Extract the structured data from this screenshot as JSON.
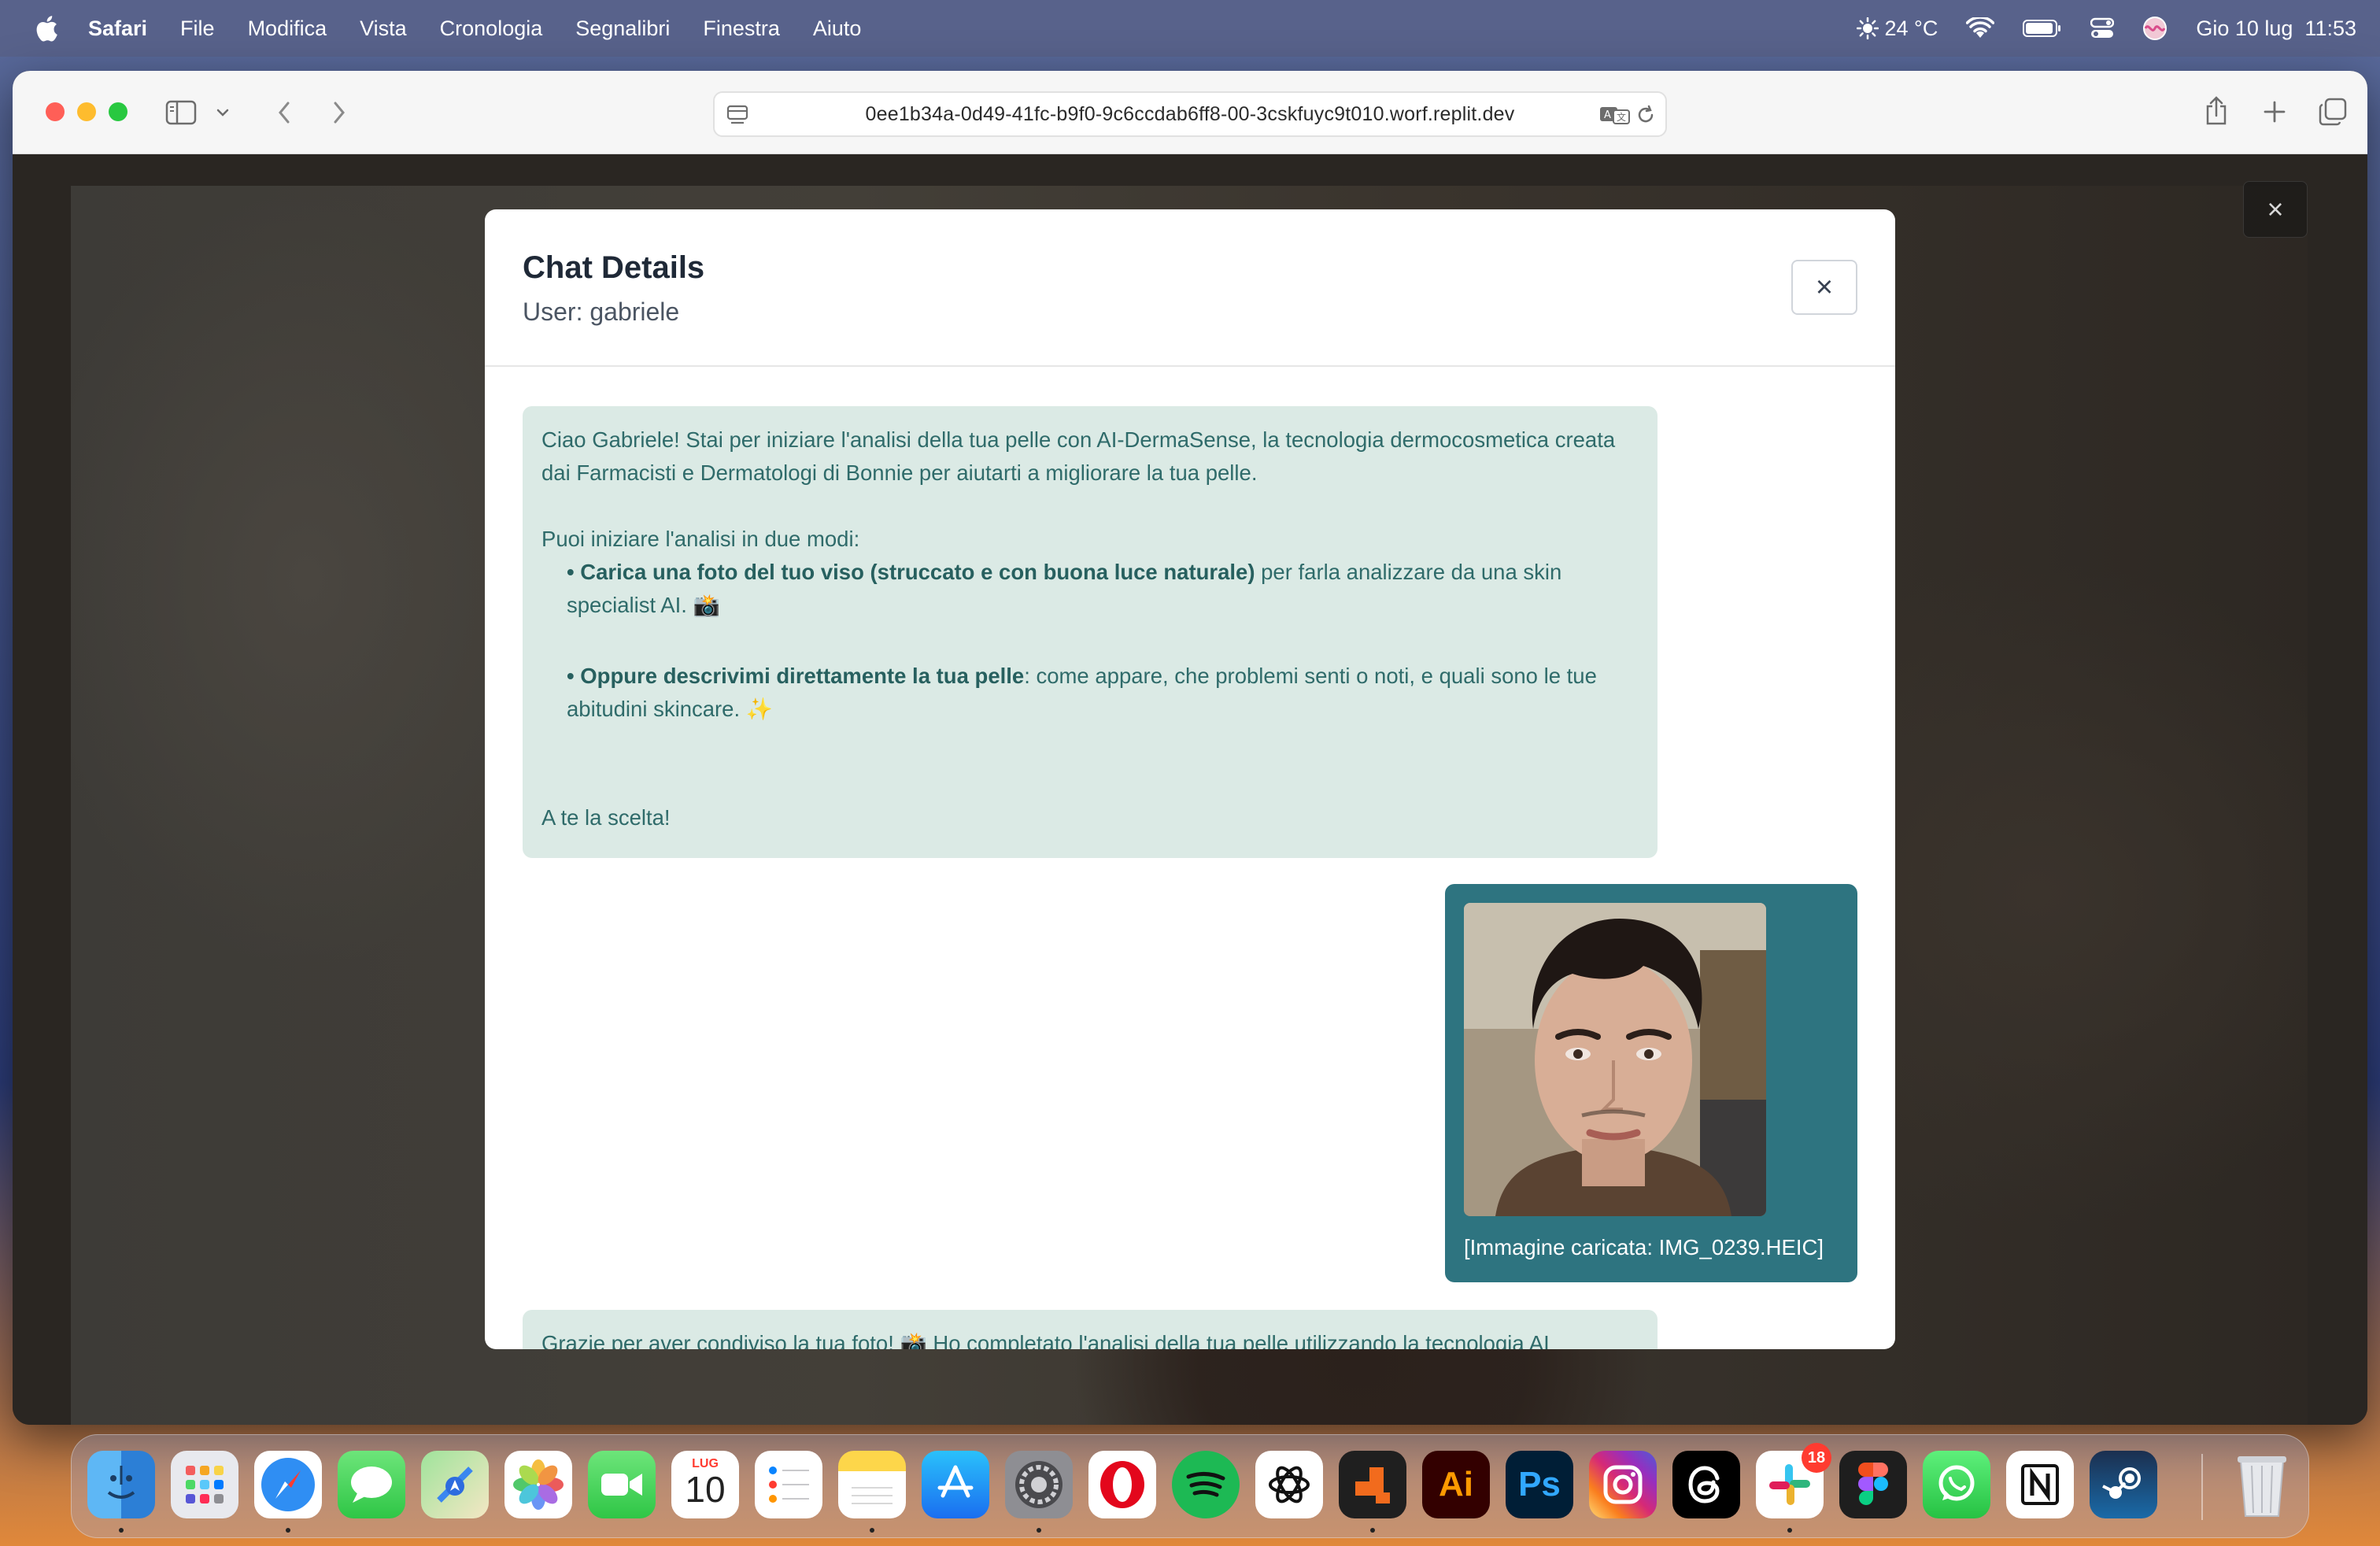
{
  "menubar": {
    "app_name": "Safari",
    "items": [
      "File",
      "Modifica",
      "Vista",
      "Cronologia",
      "Segnalibri",
      "Finestra",
      "Aiuto"
    ],
    "weather": "24 °C",
    "datetime": "Gio 10 lug  11:53"
  },
  "browser": {
    "url": "0ee1b34a-0d49-41fc-b9f0-9c6ccdab6ff8-00-3cskfuyc9t010.worf.replit.dev"
  },
  "modal": {
    "title": "Chat Details",
    "subtitle": "User: gabriele",
    "close_label": "×",
    "messages": {
      "m1": {
        "intro": "Ciao Gabriele! Stai per iniziare l'analisi della tua pelle con AI-DermaSense, la tecnologia dermocosmetica creata dai Farmacisti e Dermatologi di Bonnie per aiutarti a migliorare la tua pelle.",
        "prompt": "Puoi iniziare l'analisi in due modi:",
        "opt1_bold": "• Carica una foto del tuo viso (struccato e con buona luce naturale)",
        "opt1_rest": " per farla analizzare da una skin specialist AI. 📸",
        "opt2_bold": "• Oppure descrivimi direttamente la tua pelle",
        "opt2_rest": ": come appare, che problemi senti o noti, e quali sono le tue abitudini skincare. ✨",
        "closing": "A te la scelta!"
      },
      "m2": {
        "caption": "[Immagine caricata: IMG_0239.HEIC]"
      },
      "m3": {
        "text": "Grazie per aver condiviso la tua foto! 📸 Ho completato l'analisi della tua pelle utilizzando la tecnologia AI"
      }
    }
  },
  "lightbox": {
    "close_label": "×"
  },
  "dock": {
    "calendar_month": "LUG",
    "calendar_day": "10",
    "slack_badge": "18",
    "illustrator_label": "Ai",
    "photoshop_label": "Ps"
  },
  "colors": {
    "bot_bubble": "#dbeae5",
    "bot_text": "#2f6b6a",
    "user_bubble": "#2e7480"
  }
}
